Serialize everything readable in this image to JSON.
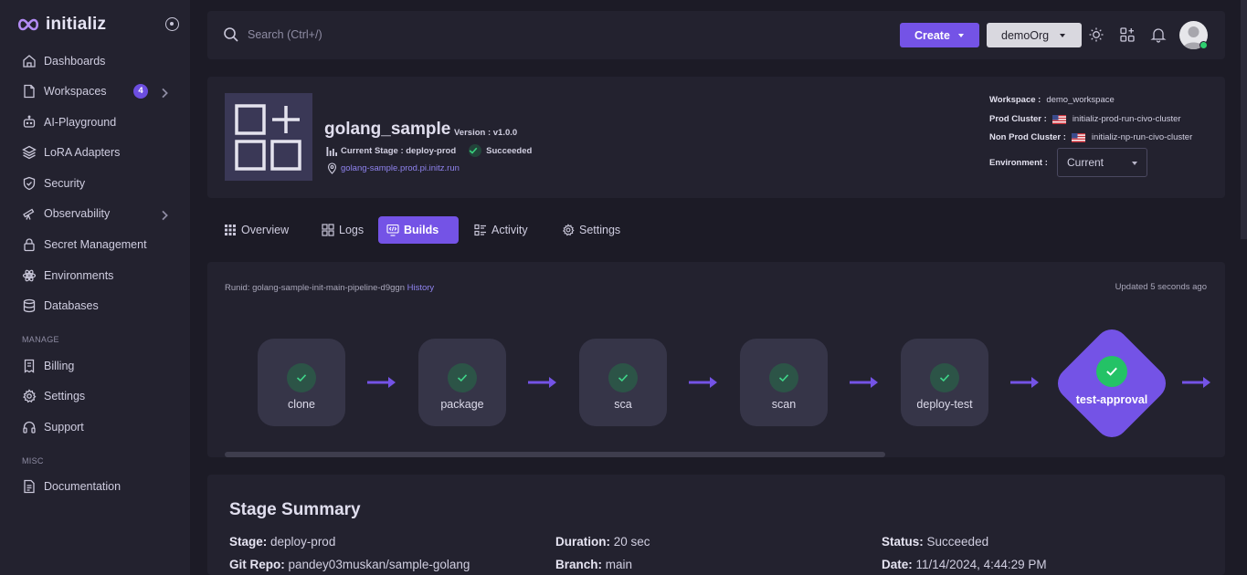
{
  "brand": {
    "name": "initializ"
  },
  "sidebar": {
    "items": [
      {
        "label": "Dashboards",
        "icon": "home-icon"
      },
      {
        "label": "Workspaces",
        "icon": "file-icon",
        "badge": "4"
      },
      {
        "label": "AI-Playground",
        "icon": "bot-icon"
      },
      {
        "label": "LoRA Adapters",
        "icon": "layers-icon"
      },
      {
        "label": "Security",
        "icon": "shield-icon"
      },
      {
        "label": "Observability",
        "icon": "telescope-icon"
      },
      {
        "label": "Secret Management",
        "icon": "lock-icon"
      },
      {
        "label": "Environments",
        "icon": "atom-icon"
      },
      {
        "label": "Databases",
        "icon": "database-icon"
      }
    ],
    "manage_header": "MANAGE",
    "manage_items": [
      {
        "label": "Billing",
        "icon": "receipt-icon"
      },
      {
        "label": "Settings",
        "icon": "gear-icon"
      },
      {
        "label": "Support",
        "icon": "headset-icon"
      }
    ],
    "misc_header": "MISC",
    "misc_items": [
      {
        "label": "Documentation",
        "icon": "document-icon"
      }
    ]
  },
  "topbar": {
    "search_placeholder": "Search (Ctrl+/)",
    "create_label": "Create",
    "org_label": "demoOrg"
  },
  "project": {
    "name": "golang_sample",
    "version": "Version : v1.0.0",
    "current_stage": "Current Stage : deploy-prod",
    "status": "Succeeded",
    "url": "golang-sample.prod.pi.initz.run",
    "workspace_label": "Workspace :",
    "workspace": "demo_workspace",
    "prod_cluster_label": "Prod Cluster :",
    "prod_cluster": "initializ-prod-run-civo-cluster",
    "nonprod_cluster_label": "Non Prod Cluster :",
    "nonprod_cluster": "initializ-np-run-civo-cluster",
    "environment_label": "Environment :",
    "environment": "Current"
  },
  "tabs": [
    {
      "label": "Overview",
      "icon": "grid-icon"
    },
    {
      "label": "Logs",
      "icon": "panels-icon"
    },
    {
      "label": "Builds",
      "icon": "code-monitor-icon",
      "active": true
    },
    {
      "label": "Activity",
      "icon": "activity-list-icon"
    },
    {
      "label": "Settings",
      "icon": "gear-icon"
    }
  ],
  "builds": {
    "runid_label": "Runid: golang-sample-init-main-pipeline-d9ggn",
    "history_label": "History",
    "updated": "Updated 5 seconds ago",
    "stages": [
      "clone",
      "package",
      "sca",
      "scan",
      "deploy-test",
      "test-approval"
    ]
  },
  "summary": {
    "title": "Stage Summary",
    "stage_label": "Stage:",
    "stage": "deploy-prod",
    "git_label": "Git Repo:",
    "git": "pandey03muskan/sample-golang",
    "duration_label": "Duration:",
    "duration": "20 sec",
    "branch_label": "Branch:",
    "branch": "main",
    "status_label": "Status:",
    "status": "Succeeded",
    "date_label": "Date:",
    "date": "11/14/2024, 4:44:29 PM"
  },
  "colors": {
    "accent": "#7453e6",
    "background": "#1c1b26",
    "card": "#23222f",
    "success": "#24c266"
  }
}
